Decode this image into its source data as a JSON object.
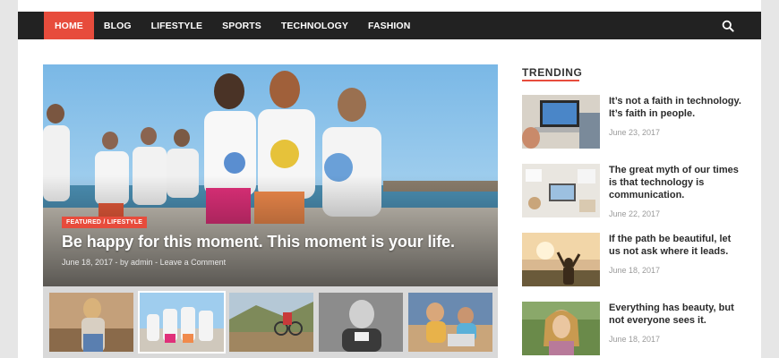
{
  "nav": {
    "items": [
      {
        "label": "HOME",
        "active": true
      },
      {
        "label": "BLOG"
      },
      {
        "label": "LIFESTYLE"
      },
      {
        "label": "SPORTS"
      },
      {
        "label": "TECHNOLOGY"
      },
      {
        "label": "FASHION"
      }
    ],
    "search_icon": "search-icon"
  },
  "featured": {
    "categories": "FEATURED / LIFESTYLE",
    "title": "Be happy for this moment. This moment is your life.",
    "meta": "June 18, 2017  -  by admin  -  Leave a Comment"
  },
  "trending": {
    "heading": "TRENDING",
    "items": [
      {
        "title": "It’s not a faith in technology. It’s faith in people.",
        "date": "June 23, 2017"
      },
      {
        "title": "The great myth of our times is that technology is communication.",
        "date": "June 22, 2017"
      },
      {
        "title": "If the path be beautiful, let us not ask where it leads.",
        "date": "June 18, 2017"
      },
      {
        "title": "Everything has beauty, but not everyone sees it.",
        "date": "June 18, 2017"
      }
    ]
  },
  "colors": {
    "accent": "#e74c3c",
    "nav_bg": "#222222"
  }
}
